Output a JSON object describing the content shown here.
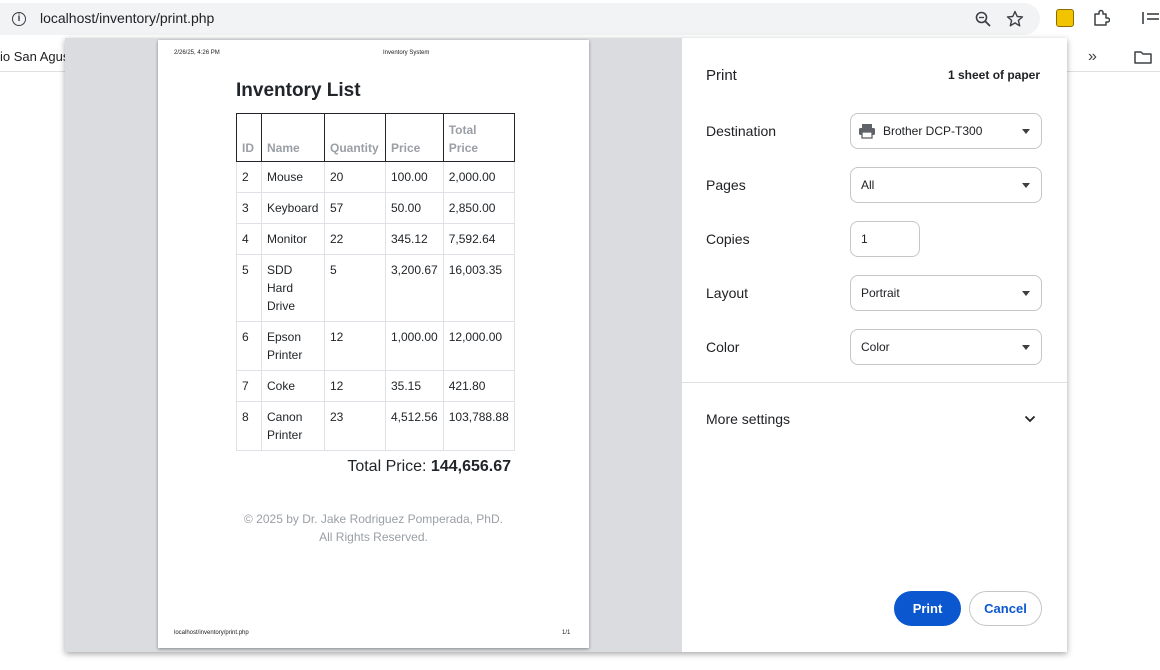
{
  "browser": {
    "url": "localhost/inventory/print.php",
    "bookmark_partial": "io San Agust",
    "overflow_chevrons": "»"
  },
  "preview": {
    "header_date": "2/26/25, 4:26 PM",
    "header_title": "Inventory System",
    "doc_title": "Inventory List",
    "columns": [
      "ID",
      "Name",
      "Quantity",
      "Price",
      "Total Price"
    ],
    "rows": [
      [
        "2",
        "Mouse",
        "20",
        "100.00",
        "2,000.00"
      ],
      [
        "3",
        "Keyboard",
        "57",
        "50.00",
        "2,850.00"
      ],
      [
        "4",
        "Monitor",
        "22",
        "345.12",
        "7,592.64"
      ],
      [
        "5",
        "SDD Hard Drive",
        "5",
        "3,200.67",
        "16,003.35"
      ],
      [
        "6",
        "Epson Printer",
        "12",
        "1,000.00",
        "12,000.00"
      ],
      [
        "7",
        "Coke",
        "12",
        "35.15",
        "421.80"
      ],
      [
        "8",
        "Canon Printer",
        "23",
        "4,512.56",
        "103,788.88"
      ]
    ],
    "total_label": "Total Price:",
    "total_value": "144,656.67",
    "footer_line1": "© 2025 by Dr. Jake Rodriguez Pomperada, PhD.",
    "footer_line2": "All Rights Reserved.",
    "footer_url": "localhost/inventory/print.php",
    "page_number": "1/1"
  },
  "settings": {
    "title": "Print",
    "sheet_count": "1 sheet of paper",
    "destination_label": "Destination",
    "destination_value": "Brother DCP-T300",
    "pages_label": "Pages",
    "pages_value": "All",
    "copies_label": "Copies",
    "copies_value": "1",
    "layout_label": "Layout",
    "layout_value": "Portrait",
    "color_label": "Color",
    "color_value": "Color",
    "more_settings": "More settings",
    "print_button": "Print",
    "cancel_button": "Cancel"
  },
  "colors": {
    "accent": "#0b57d0",
    "preview_bg": "#dadce0"
  }
}
